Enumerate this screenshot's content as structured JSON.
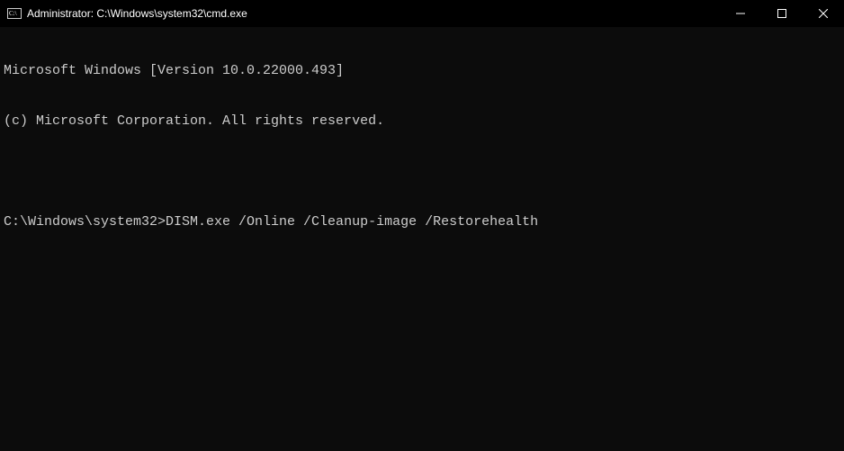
{
  "titlebar": {
    "title": "Administrator: C:\\Windows\\system32\\cmd.exe"
  },
  "terminal": {
    "line1": "Microsoft Windows [Version 10.0.22000.493]",
    "line2": "(c) Microsoft Corporation. All rights reserved.",
    "prompt": "C:\\Windows\\system32>",
    "command": "DISM.exe /Online /Cleanup-image /Restorehealth"
  }
}
